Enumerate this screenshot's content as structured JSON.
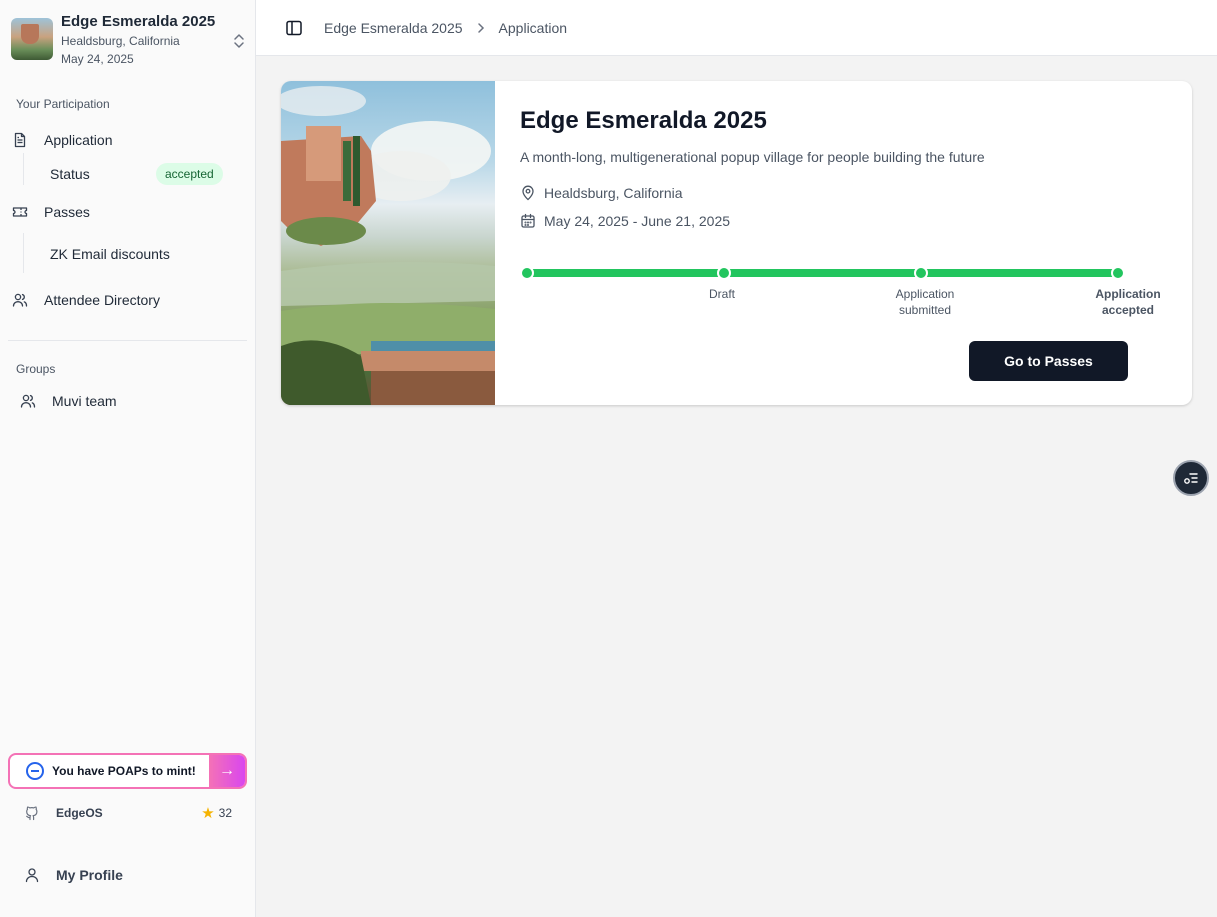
{
  "event": {
    "title": "Edge Esmeralda 2025",
    "location": "Healdsburg, California",
    "date": "May 24, 2025"
  },
  "sidebar": {
    "participation_label": "Your Participation",
    "application": "Application",
    "status_label": "Status",
    "status_value": "accepted",
    "passes": "Passes",
    "zk_email": "ZK Email discounts",
    "attendee_directory": "Attendee Directory",
    "groups_label": "Groups",
    "group_item": "Muvi team",
    "poap_text": "You have POAPs to mint!",
    "github_name": "EdgeOS",
    "github_stars": "32",
    "profile": "My Profile"
  },
  "header": {
    "crumb_event": "Edge Esmeralda 2025",
    "crumb_page": "Application"
  },
  "card": {
    "title": "Edge Esmeralda 2025",
    "description": "A month-long, multigenerational popup village for people building the future",
    "location": "Healdsburg, California",
    "dates": "May 24, 2025 - June 21, 2025",
    "steps": [
      "Draft",
      "Application submitted",
      "Application accepted"
    ],
    "button": "Go to Passes"
  },
  "colors": {
    "accent_green": "#22c55e",
    "button_dark": "#111827",
    "badge_bg": "#dcfce7",
    "poap_gradient_start": "#f472b6",
    "poap_gradient_end": "#d946ef"
  },
  "icons": {
    "application": "file-text-icon",
    "passes": "ticket-icon",
    "directory": "users-icon",
    "group": "users-icon",
    "github": "github-icon",
    "profile": "user-icon",
    "location": "map-pin-icon",
    "calendar": "calendar-icon",
    "sidebar_toggle": "panel-left-icon",
    "fab": "list-settings-icon"
  }
}
